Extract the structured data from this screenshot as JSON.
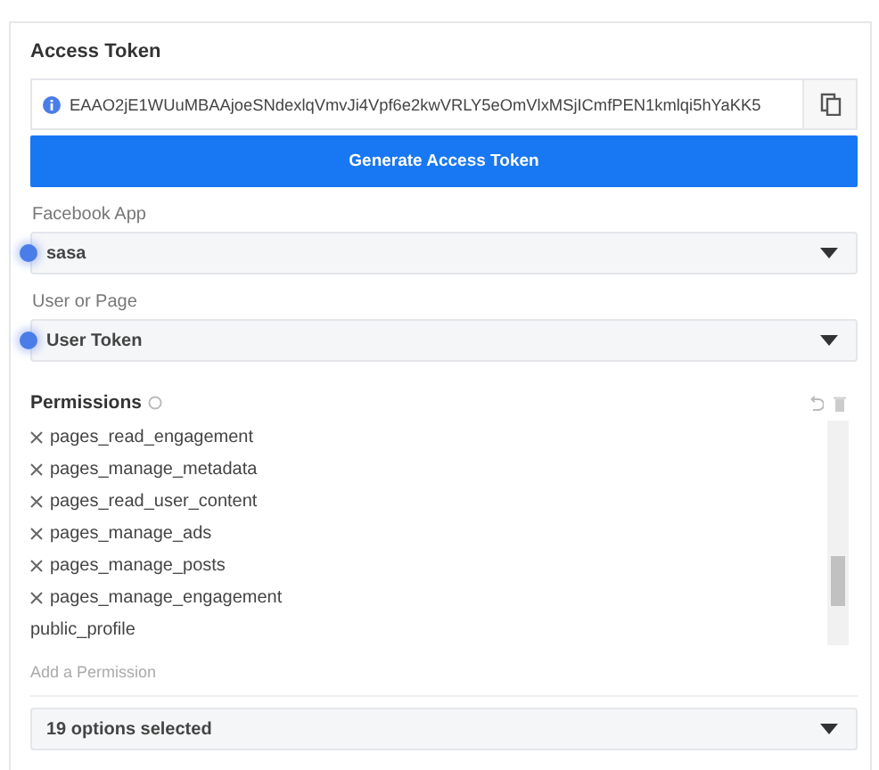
{
  "title": "Access Token",
  "token": {
    "value": "EAAO2jE1WUuMBAAjoeSNdexlqVmvJi4Vpf6e2kwVRLY5eOmVlxMSjICmfPEN1kmlqi5hYaKK5"
  },
  "generate_button": "Generate Access Token",
  "fields": [
    {
      "label": "Facebook App",
      "value": "sasa"
    },
    {
      "label": "User or Page",
      "value": "User Token"
    }
  ],
  "permissions": {
    "title": "Permissions",
    "items": [
      {
        "name": "pages_read_engagement",
        "removable": true
      },
      {
        "name": "pages_manage_metadata",
        "removable": true
      },
      {
        "name": "pages_read_user_content",
        "removable": true
      },
      {
        "name": "pages_manage_ads",
        "removable": true
      },
      {
        "name": "pages_manage_posts",
        "removable": true
      },
      {
        "name": "pages_manage_engagement",
        "removable": true
      },
      {
        "name": "public_profile",
        "removable": false
      }
    ],
    "add_placeholder": "Add a Permission",
    "summary": "19 options selected"
  }
}
